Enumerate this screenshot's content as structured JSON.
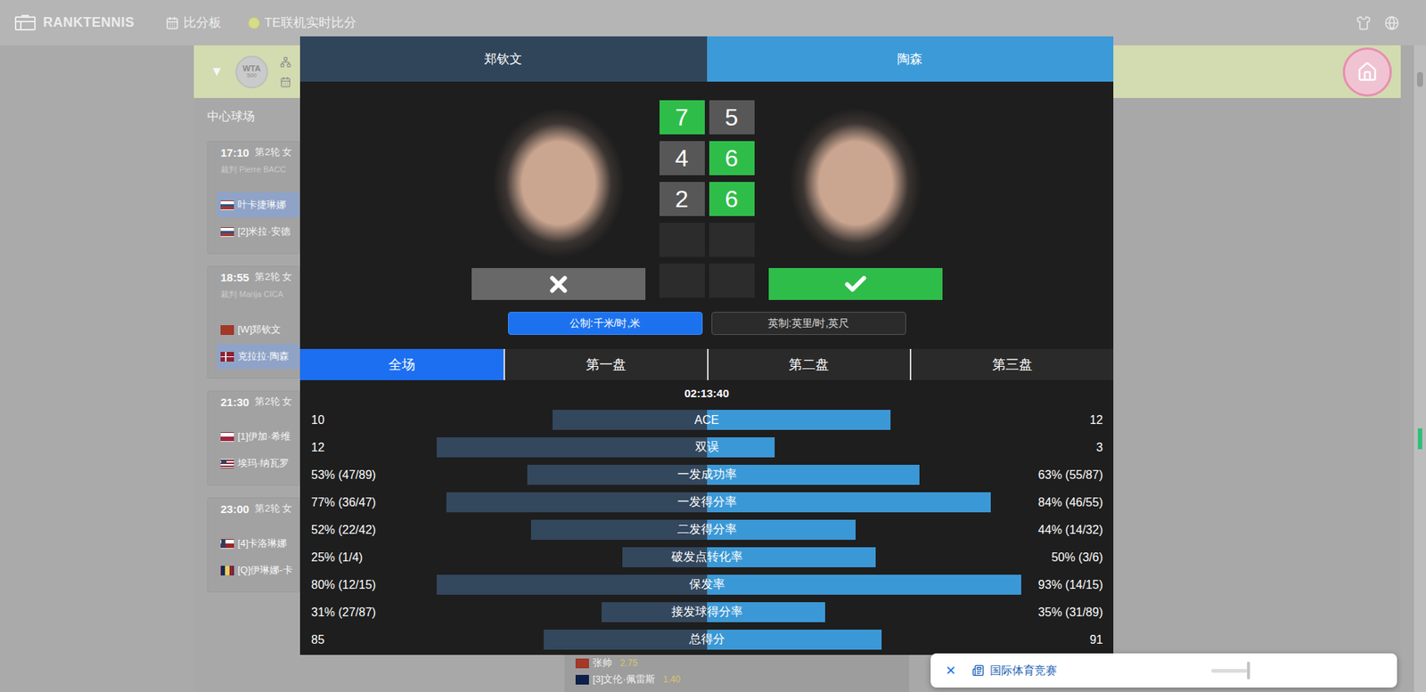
{
  "topbar": {
    "logo": "RANKTENNIS",
    "nav": [
      {
        "label": "比分板",
        "kind": "calendar"
      },
      {
        "label": "TE联机实时比分",
        "kind": "ball"
      }
    ]
  },
  "tournament": {
    "toggle": "▼",
    "expanded": true,
    "badge": {
      "name": "WTA",
      "tier": "500"
    }
  },
  "court": {
    "title": "中心球场",
    "matches": [
      {
        "time": "17:10",
        "round": "第2轮 女",
        "umpire": "裁判 Pierre BACC",
        "players": [
          {
            "name": "叶卡捷琳娜",
            "flag": "ru",
            "selected": true
          },
          {
            "name": "[2]米拉·安德",
            "flag": "ru",
            "selected": false
          }
        ]
      },
      {
        "time": "18:55",
        "round": "第2轮 女",
        "umpire": "裁判 Marija CICA",
        "players": [
          {
            "name": "[W]郑钦文",
            "flag": "cn",
            "selected": false
          },
          {
            "name": "克拉拉·陶森",
            "flag": "dk",
            "selected": true
          }
        ]
      },
      {
        "time": "21:30",
        "round": "第2轮 女",
        "players": [
          {
            "name": "[1]伊加·希维",
            "flag": "pl",
            "selected": false
          },
          {
            "name": "埃玛·纳瓦罗",
            "flag": "us",
            "selected": false
          }
        ]
      },
      {
        "time": "23:00",
        "round": "第2轮 女",
        "players": [
          {
            "name": "[4]卡洛琳娜",
            "flag": "cz",
            "selected": false
          },
          {
            "name": "[Q]伊琳娜-卡",
            "flag": "ro",
            "selected": false
          }
        ]
      }
    ]
  },
  "odds": [
    {
      "name": "张帅",
      "odds": "2.75",
      "flag": "cn"
    },
    {
      "name": "[3]文伦·佩雷斯",
      "odds": "1.40",
      "flag": "au"
    }
  ],
  "match_dialog": {
    "players": [
      {
        "name": "郑钦文",
        "won": false
      },
      {
        "name": "陶森",
        "won": true
      }
    ],
    "sets": [
      {
        "scores": [
          "7",
          "5"
        ],
        "won": [
          true,
          false
        ],
        "played": true
      },
      {
        "scores": [
          "4",
          "6"
        ],
        "won": [
          false,
          true
        ],
        "played": true
      },
      {
        "scores": [
          "2",
          "6"
        ],
        "won": [
          false,
          true
        ],
        "played": true
      },
      {
        "scores": [
          "",
          ""
        ],
        "won": [
          false,
          false
        ],
        "played": false
      },
      {
        "scores": [
          "",
          ""
        ],
        "won": [
          false,
          false
        ],
        "played": false
      }
    ],
    "units": [
      {
        "label": "公制:千米/时,米",
        "selected": true
      },
      {
        "label": "英制:英里/时,英尺",
        "selected": false
      }
    ],
    "tabs": [
      {
        "label": "全场",
        "selected": true
      },
      {
        "label": "第一盘",
        "selected": false
      },
      {
        "label": "第二盘",
        "selected": false
      },
      {
        "label": "第三盘",
        "selected": false
      }
    ],
    "duration": "02:13:40",
    "stats": [
      {
        "label": "ACE",
        "left": "10",
        "right": "12",
        "left_level": 0.455,
        "right_level": 0.545
      },
      {
        "label": "双误",
        "left": "12",
        "right": "3",
        "left_level": 0.8,
        "right_level": 0.2
      },
      {
        "label": "一发成功率",
        "left": "53% (47/89)",
        "right": "63% (55/87)",
        "left_level": 0.53,
        "right_level": 0.63
      },
      {
        "label": "一发得分率",
        "left": "77% (36/47)",
        "right": "84% (46/55)",
        "left_level": 0.77,
        "right_level": 0.84
      },
      {
        "label": "二发得分率",
        "left": "52% (22/42)",
        "right": "44% (14/32)",
        "left_level": 0.52,
        "right_level": 0.44
      },
      {
        "label": "破发点转化率",
        "left": "25% (1/4)",
        "right": "50% (3/6)",
        "left_level": 0.25,
        "right_level": 0.5
      },
      {
        "label": "保发率",
        "left": "80% (12/15)",
        "right": "93% (14/15)",
        "left_level": 0.8,
        "right_level": 0.93
      },
      {
        "label": "接发球得分率",
        "left": "31% (27/87)",
        "right": "35% (31/89)",
        "left_level": 0.31,
        "right_level": 0.35
      },
      {
        "label": "总得分",
        "left": "85",
        "right": "91",
        "left_level": 0.483,
        "right_level": 0.517
      }
    ]
  },
  "notification": {
    "close": "✕",
    "text": "国际体育竞赛"
  }
}
